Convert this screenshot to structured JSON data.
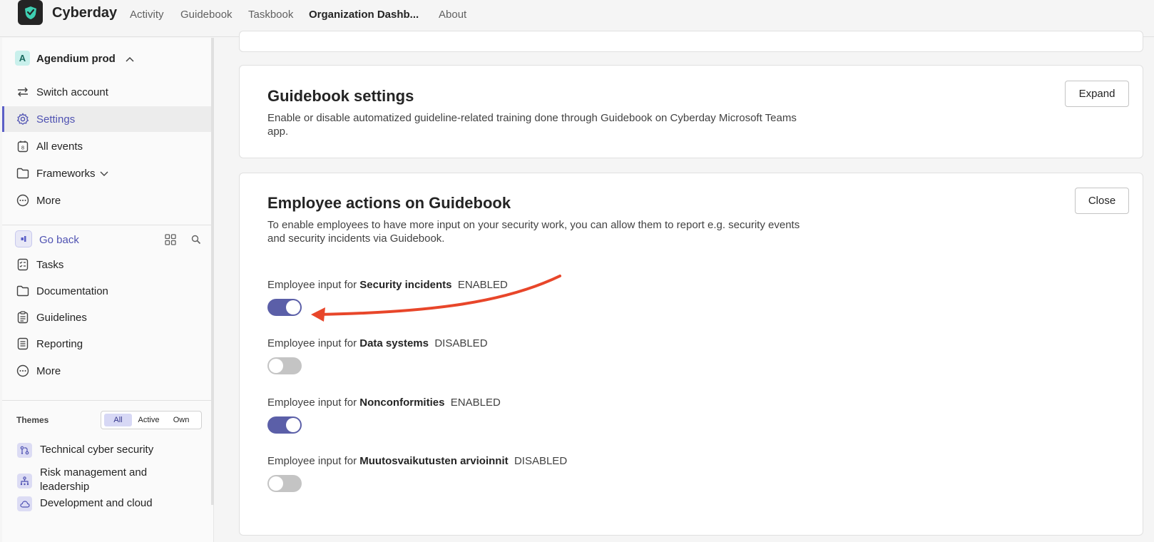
{
  "app": {
    "name": "Cyberday"
  },
  "nav": {
    "tabs": [
      {
        "label": "Activity"
      },
      {
        "label": "Guidebook"
      },
      {
        "label": "Taskbook"
      },
      {
        "label": "Organization Dashb..."
      },
      {
        "label": "About"
      }
    ]
  },
  "sidebar": {
    "account": {
      "initial": "A",
      "name": "Agendium prod"
    },
    "menu": [
      {
        "label": "Switch account",
        "icon": "switch-icon"
      },
      {
        "label": "Settings",
        "icon": "gear-icon"
      },
      {
        "label": "All events",
        "icon": "calendar-icon"
      },
      {
        "label": "Frameworks",
        "icon": "folder-icon"
      },
      {
        "label": "More",
        "icon": "more-icon"
      }
    ],
    "go_back": "Go back",
    "section": [
      {
        "label": "Tasks",
        "icon": "tasks-icon"
      },
      {
        "label": "Documentation",
        "icon": "folder-icon"
      },
      {
        "label": "Guidelines",
        "icon": "clipboard-icon"
      },
      {
        "label": "Reporting",
        "icon": "report-icon"
      },
      {
        "label": "More",
        "icon": "more-icon"
      }
    ],
    "themes": {
      "label": "Themes",
      "filters": [
        "All",
        "Active",
        "Own"
      ],
      "selected": "All",
      "items": [
        {
          "label": "Technical cyber security",
          "icon": "branch-icon"
        },
        {
          "label": "Risk management and leadership",
          "icon": "hierarchy-icon"
        },
        {
          "label": "Development and cloud",
          "icon": "cloud-icon"
        }
      ]
    }
  },
  "guidebook_settings": {
    "title": "Guidebook settings",
    "description": "Enable or disable automatized guideline-related training done through Guidebook on Cyberday Microsoft Teams app.",
    "button": "Expand"
  },
  "employee_actions": {
    "title": "Employee actions on Guidebook",
    "description": "To enable employees to have more input on your security work, you can allow them to report e.g. security events and security incidents via Guidebook.",
    "button": "Close",
    "prefix": "Employee input for",
    "options": [
      {
        "name": "Security incidents",
        "status": "ENABLED",
        "enabled": true
      },
      {
        "name": "Data systems",
        "status": "DISABLED",
        "enabled": false
      },
      {
        "name": "Nonconformities",
        "status": "ENABLED",
        "enabled": true
      },
      {
        "name": "Muutosvaikutusten arvioinnit",
        "status": "DISABLED",
        "enabled": false
      }
    ]
  },
  "colors": {
    "accent": "#5b5fc7",
    "toggle_on": "#5b5fa8",
    "toggle_off": "#c4c4c4",
    "arrow": "#e8462a"
  }
}
